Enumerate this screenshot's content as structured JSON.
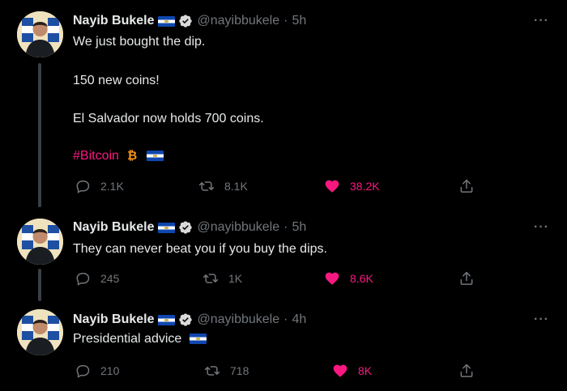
{
  "colors": {
    "background": "#000000",
    "text": "#e7e9ea",
    "muted": "#71767b",
    "pink": "#f91880",
    "verified": "#d9d9d9"
  },
  "tweets": [
    {
      "name": "Nayib Bukele",
      "handle": "@nayibbukele",
      "time": "5h",
      "lines": [
        "We just bought the dip.",
        "150 new coins!",
        "El Salvador now holds 700 coins."
      ],
      "hashtag": "#Bitcoin",
      "replies": "2.1K",
      "retweets": "8.1K",
      "likes": "38.2K"
    },
    {
      "name": "Nayib Bukele",
      "handle": "@nayibbukele",
      "time": "5h",
      "lines": [
        "They can never beat you if you buy the dips."
      ],
      "replies": "245",
      "retweets": "1K",
      "likes": "8.6K"
    },
    {
      "name": "Nayib Bukele",
      "handle": "@nayibbukele",
      "time": "4h",
      "lines": [
        "Presidential advice"
      ],
      "replies": "210",
      "retweets": "718",
      "likes": "8K"
    }
  ],
  "icons": [
    "verified-badge-icon",
    "flag-el-salvador-icon",
    "bitcoin-icon",
    "more-icon",
    "reply-icon",
    "retweet-icon",
    "like-icon",
    "share-icon"
  ]
}
